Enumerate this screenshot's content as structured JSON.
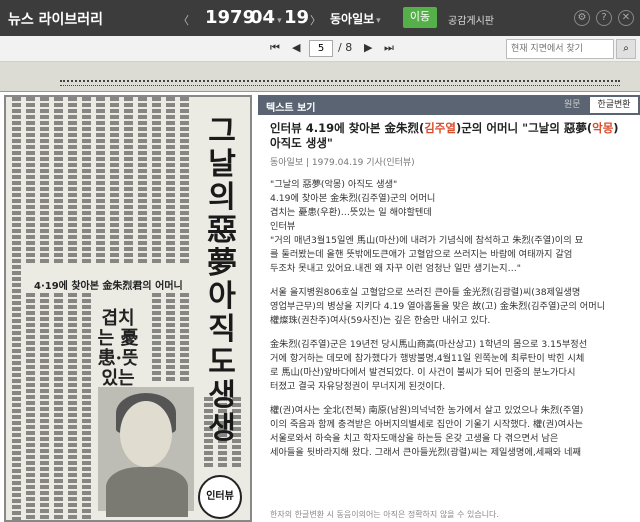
{
  "topbar": {
    "brand": "뉴스 라이브러리",
    "year": "1979",
    "month": "04",
    "day": "19",
    "newspaper": "동아일보",
    "go_label": "이동",
    "board_label": "공감게시판",
    "prev_arrow": "〈",
    "next_arrow": "〉"
  },
  "pagebar": {
    "first": "⏮",
    "prev": "◀",
    "current_page": "5",
    "total_pages": "/ 8",
    "next": "▶",
    "last": "⏭",
    "search_placeholder": "현재 지면에서 찾기"
  },
  "scan": {
    "headline": "그날의 惡夢 아직도 생생",
    "subhead": "4·19에 찾아본 金朱烈君의 어머니",
    "sidehead": "겹치는 憂患·뜻있는 일 해야할텐데",
    "badge": "인터뷰"
  },
  "textview": {
    "header": "텍스트 보기",
    "tab_original": "원문",
    "tab_convert": "한글변환",
    "title_a": "인터뷰 4.19에 찾아본 金朱烈(",
    "title_hl1": "김주열",
    "title_b": ")군의 어머니 \"그날의 惡夢(",
    "title_hl2": "악몽",
    "title_c": ")",
    "title_d": "아직도 생생\"",
    "meta": "동아일보 | 1979.04.19 기사(인터뷰)",
    "lines": [
      "\"그날의 惡夢(악몽) 아직도 생생\"",
      "4.19에 찾아본 金朱烈(김주열)군의 어머니",
      "겹치는 憂患(우환)…뜻있는 일 해야할텐데",
      "인터뷰",
      "\"거의 매년3월15일엔 馬山(마산)에 내려가 기념식에 참석하고 朱烈(주열)이의 묘",
      "를 둘러봤는데 올핸 뜻밖에도큰애가 고혈압으로 쓰러지는 바람에 여태까지 갈엄",
      "두조차 못내고 있어요.내겐 왜 자꾸 이런 엄청난 일만 생기는지…\"",
      "",
      "서울 을지병원806호실 고혈압으로 쓰러진 큰아들 金光烈(김광렬)씨(38제일생명",
      "영업부근무)의 병상을 지키다 4.19 열아홉돌을 맞은 故(고) 金朱烈(김주열)군의 어머니",
      "權燦珠(권찬주)여사(59사진)는 깊은 한숨만 내쉬고 있다.",
      "",
      "金朱烈(김주열)군은 19년전 당시馬山商高(마산상고) 1학년의 몸으로 3.15부정선",
      "거에 항거하는 데모에 참가했다가 행방불명,4월11일 왼쪽눈에 최루탄이 박힌 시체",
      "로 馬山(마산)앞바다에서 발견되었다. 이 사건이 불씨가 되어 민중의 분노가다시",
      "터졌고 결국 자유당정권이 무너지게 된것이다.",
      "",
      "權(권)여사는 全北(전북) 南原(남원)의넉넉한 농가에서 살고 있었으나 朱烈(주열)",
      "이의 죽음과 함께 충격받은 아버지의별세로 집안이 기울기 시작했다. 權(권)여사는",
      "서울로와서 하숙을 치고 학자도매상을 하는등 온갖 고생을 다 겪으면서 남은",
      "세아들을 뒷바라지해 왔다. 그래서 큰아들光烈(광렬)씨는 제일생명에,세째와 네째"
    ],
    "footnote": "한자의 한글변환 시 동음이의어는 아직은 정확하지 않을 수 있습니다."
  }
}
